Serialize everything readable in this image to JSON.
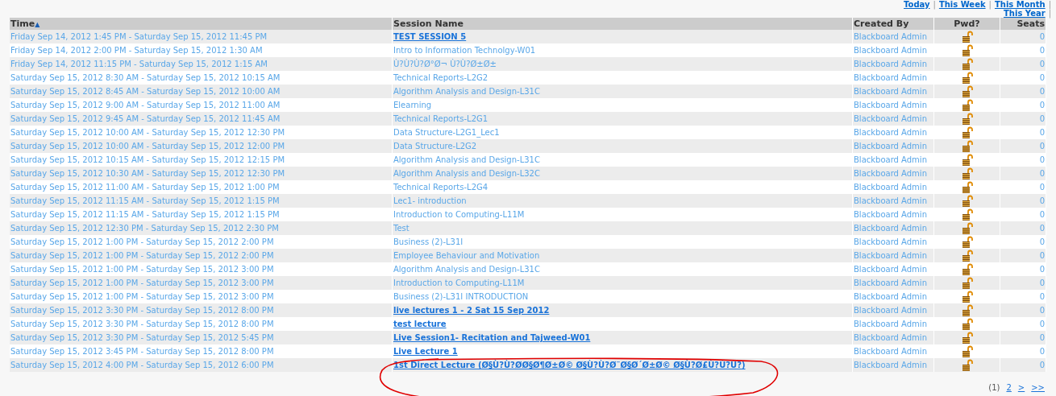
{
  "range_links": [
    {
      "label": "Today"
    },
    {
      "label": "This Week"
    },
    {
      "label": "This Month"
    },
    {
      "label": "This Year"
    }
  ],
  "separator": "|",
  "table": {
    "columns": [
      {
        "label": "Time",
        "sort_icon": "▲"
      },
      {
        "label": "Session Name"
      },
      {
        "label": "Created By"
      },
      {
        "label": "Pwd?"
      },
      {
        "label": "Seats"
      }
    ],
    "rows": [
      {
        "time": "Friday Sep 14, 2012 1:45 PM - Saturday Sep 15, 2012 11:45 PM",
        "session": "TEST SESSION 5",
        "bold": true,
        "created_by": "Blackboard Admin",
        "seats": "0"
      },
      {
        "time": "Friday Sep 14, 2012 2:00 PM - Saturday Sep 15, 2012 1:30 AM",
        "session": "Intro to Information Technolgy-W01",
        "bold": false,
        "created_by": "Blackboard Admin",
        "seats": "0"
      },
      {
        "time": "Friday Sep 14, 2012 11:15 PM - Saturday Sep 15, 2012 1:15 AM",
        "session": "Ù?Ù?Ù?Ø°Ø¬ Ù?Ù?Ø±Ø±",
        "bold": false,
        "created_by": "Blackboard Admin",
        "seats": "0"
      },
      {
        "time": "Saturday Sep 15, 2012 8:30 AM - Saturday Sep 15, 2012 10:15 AM",
        "session": "Technical Reports-L2G2",
        "bold": false,
        "created_by": "Blackboard Admin",
        "seats": "0"
      },
      {
        "time": "Saturday Sep 15, 2012 8:45 AM - Saturday Sep 15, 2012 10:00 AM",
        "session": "Algorithm Analysis and Design-L31C",
        "bold": false,
        "created_by": "Blackboard Admin",
        "seats": "0"
      },
      {
        "time": "Saturday Sep 15, 2012 9:00 AM - Saturday Sep 15, 2012 11:00 AM",
        "session": "Elearning",
        "bold": false,
        "created_by": "Blackboard Admin",
        "seats": "0"
      },
      {
        "time": "Saturday Sep 15, 2012 9:45 AM - Saturday Sep 15, 2012 11:45 AM",
        "session": "Technical Reports-L2G1",
        "bold": false,
        "created_by": "Blackboard Admin",
        "seats": "0"
      },
      {
        "time": "Saturday Sep 15, 2012 10:00 AM - Saturday Sep 15, 2012 12:30 PM",
        "session": "Data Structure-L2G1_Lec1",
        "bold": false,
        "created_by": "Blackboard Admin",
        "seats": "0"
      },
      {
        "time": "Saturday Sep 15, 2012 10:00 AM - Saturday Sep 15, 2012 12:00 PM",
        "session": "Data Structure-L2G2",
        "bold": false,
        "created_by": "Blackboard Admin",
        "seats": "0"
      },
      {
        "time": "Saturday Sep 15, 2012 10:15 AM - Saturday Sep 15, 2012 12:15 PM",
        "session": "Algorithm Analysis and Design-L31C",
        "bold": false,
        "created_by": "Blackboard Admin",
        "seats": "0"
      },
      {
        "time": "Saturday Sep 15, 2012 10:30 AM - Saturday Sep 15, 2012 12:30 PM",
        "session": "Algorithm Analysis and Design-L32C",
        "bold": false,
        "created_by": "Blackboard Admin",
        "seats": "0"
      },
      {
        "time": "Saturday Sep 15, 2012 11:00 AM - Saturday Sep 15, 2012 1:00 PM",
        "session": "Technical Reports-L2G4",
        "bold": false,
        "created_by": "Blackboard Admin",
        "seats": "0"
      },
      {
        "time": "Saturday Sep 15, 2012 11:15 AM - Saturday Sep 15, 2012 1:15 PM",
        "session": "Lec1- introduction",
        "bold": false,
        "created_by": "Blackboard Admin",
        "seats": "0"
      },
      {
        "time": "Saturday Sep 15, 2012 11:15 AM - Saturday Sep 15, 2012 1:15 PM",
        "session": "Introduction to Computing-L11M",
        "bold": false,
        "created_by": "Blackboard Admin",
        "seats": "0"
      },
      {
        "time": "Saturday Sep 15, 2012 12:30 PM - Saturday Sep 15, 2012 2:30 PM",
        "session": "Test",
        "bold": false,
        "created_by": "Blackboard Admin",
        "seats": "0"
      },
      {
        "time": "Saturday Sep 15, 2012 1:00 PM - Saturday Sep 15, 2012 2:00 PM",
        "session": "Business (2)-L31I",
        "bold": false,
        "created_by": "Blackboard Admin",
        "seats": "0"
      },
      {
        "time": "Saturday Sep 15, 2012 1:00 PM - Saturday Sep 15, 2012 2:00 PM",
        "session": "Employee Behaviour and Motivation",
        "bold": false,
        "created_by": "Blackboard Admin",
        "seats": "0"
      },
      {
        "time": "Saturday Sep 15, 2012 1:00 PM - Saturday Sep 15, 2012 3:00 PM",
        "session": "Algorithm Analysis and Design-L31C",
        "bold": false,
        "created_by": "Blackboard Admin",
        "seats": "0"
      },
      {
        "time": "Saturday Sep 15, 2012 1:00 PM - Saturday Sep 15, 2012 3:00 PM",
        "session": "Introduction to Computing-L11M",
        "bold": false,
        "created_by": "Blackboard Admin",
        "seats": "0"
      },
      {
        "time": "Saturday Sep 15, 2012 1:00 PM - Saturday Sep 15, 2012 3:00 PM",
        "session": "Business (2)-L31I INTRODUCTION",
        "bold": false,
        "created_by": "Blackboard Admin",
        "seats": "0"
      },
      {
        "time": "Saturday Sep 15, 2012 3:30 PM - Saturday Sep 15, 2012 8:00 PM",
        "session": "live lectures 1 - 2 Sat 15 Sep 2012",
        "bold": true,
        "created_by": "Blackboard Admin",
        "seats": "0"
      },
      {
        "time": "Saturday Sep 15, 2012 3:30 PM - Saturday Sep 15, 2012 8:00 PM",
        "session": "test lecture",
        "bold": true,
        "created_by": "Blackboard Admin",
        "seats": "0"
      },
      {
        "time": "Saturday Sep 15, 2012 3:30 PM - Saturday Sep 15, 2012 5:45 PM",
        "session": "Live Session1- Recitation and Tajweed-W01",
        "bold": true,
        "created_by": "Blackboard Admin",
        "seats": "0"
      },
      {
        "time": "Saturday Sep 15, 2012 3:45 PM - Saturday Sep 15, 2012 8:00 PM",
        "session": "Live Lecture 1",
        "bold": true,
        "created_by": "Blackboard Admin",
        "seats": "0"
      },
      {
        "time": "Saturday Sep 15, 2012 4:00 PM - Saturday Sep 15, 2012 6:00 PM",
        "session": "1st Direct Lecture (Ø§Ù?Ù?ØØ§Ø¶Ø±Ø© Ø§Ù?Ù?Ø¨Ø§Ø´Ø±Ø© Ø§Ù?Ø£Ù?Ù?Ù?)",
        "bold": true,
        "created_by": "Blackboard Admin",
        "seats": "0"
      }
    ]
  },
  "pager": {
    "current": "(1)",
    "pages": [
      {
        "label": "2"
      },
      {
        "label": ">"
      },
      {
        "label": ">>"
      }
    ]
  }
}
